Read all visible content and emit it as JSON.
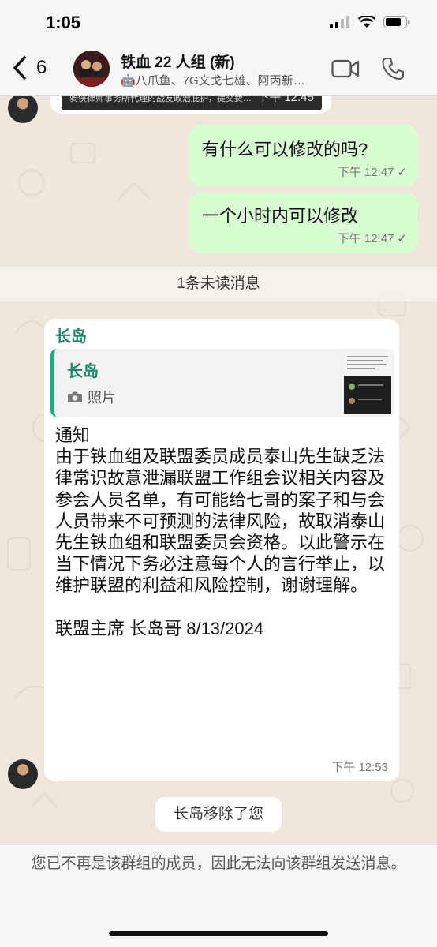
{
  "status_bar": {
    "time": "1:05"
  },
  "header": {
    "back_count": "6",
    "title": "铁血 22 人组 (新)",
    "subtitle": "🤖八爪鱼、7G文戈七雄、阿丙新…"
  },
  "chat": {
    "top_partial_text": "骑侠律师事务所代理的战友政治庇护，提交费…",
    "top_partial_time": "下午 12:45",
    "messages": [
      {
        "text": "有什么可以修改的吗?",
        "time": "下午 12:47",
        "status": "✓"
      },
      {
        "text": "一个小时内可以修改",
        "time": "下午 12:47",
        "status": "✓"
      }
    ],
    "unread_label": "1条未读消息",
    "incoming": {
      "sender": "长岛",
      "quote_sender": "长岛",
      "quote_type": "照片",
      "body": "通知\n由于铁血组及联盟委员成员泰山先生缺乏法律常识故意泄漏联盟工作组会议相关内容及参会人员名单，有可能给七哥的案子和与会人员带来不可预测的法律风险，故取消泰山先生铁血组和联盟委员会资格。以此警示在当下情况下务必注意每个人的言行举止，以维护联盟的利益和风险控制，谢谢理解。\n\n联盟主席 长岛哥 8/13/2024",
      "time": "下午 12:53"
    },
    "system_message": "长岛移除了您"
  },
  "footer": {
    "notice": "您已不再是该群组的成员，因此无法向该群组发送消息。"
  },
  "colors": {
    "accent": "#25a884",
    "out_bubble": "#d9fdd3",
    "in_bubble": "#ffffff"
  }
}
